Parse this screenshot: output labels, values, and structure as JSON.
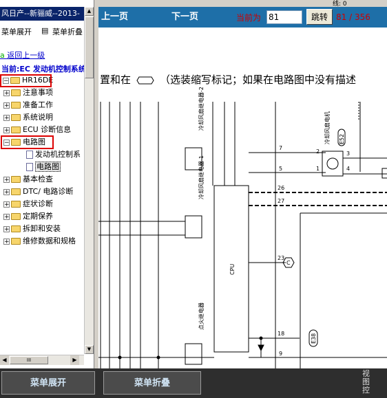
{
  "left_panel": {
    "title": "风日产--新骊威--2013-",
    "toolbar": {
      "expand_label": "菜单展开",
      "collapse_label": "菜单折叠",
      "collapse_glyph": "▤"
    },
    "go_up": "返回上一级",
    "current_location": "当前:EC 发动机控制系统",
    "tree": {
      "root": "HR16DE",
      "items": [
        {
          "label": "注意事项"
        },
        {
          "label": "准备工作"
        },
        {
          "label": "系统说明"
        },
        {
          "label": "ECU 诊断信息"
        },
        {
          "label": "电路图",
          "children": [
            "发动机控制系",
            "电路图"
          ]
        },
        {
          "label": "基本检查"
        },
        {
          "label": "DTC/ 电路诊断"
        },
        {
          "label": "症状诊断"
        },
        {
          "label": "定期保养"
        },
        {
          "label": "拆卸和安装"
        },
        {
          "label": "维修数据和规格"
        }
      ]
    },
    "hscroll_thumb": "III"
  },
  "viewer": {
    "top_strip": "线: 0",
    "prev_label": "上一页",
    "next_label": "下一页",
    "current_label": "当前为",
    "page_value": "81",
    "jump_label": "跳转",
    "page_count": "81 / 356",
    "caption_before": "置和在",
    "caption_after": "（选装缩写标记；如果在电路图中没有描述",
    "diagram": {
      "relay2_label": "冷却风扇继电器-2",
      "relay1_label": "冷却风扇继电器-1",
      "ignition_relay_label": "点火继电器",
      "motor_label": "冷却风扇电机",
      "cpu_label": "CPU",
      "conn_e52": "E52",
      "conn_e38": "E38",
      "conn_c": "C",
      "pins": [
        "7",
        "5",
        "26",
        "27",
        "23",
        "18",
        "9",
        "2",
        "1",
        "3",
        "4"
      ]
    }
  },
  "bottom_bar": {
    "expand_label": "菜单展开",
    "collapse_label": "菜单折叠",
    "side_text": "视图控"
  },
  "colors": {
    "topbar": "#1e6fa8",
    "highlight_box": "#dd0000",
    "page_count": "#cc0000",
    "bottombar": "#2e2e2e"
  }
}
